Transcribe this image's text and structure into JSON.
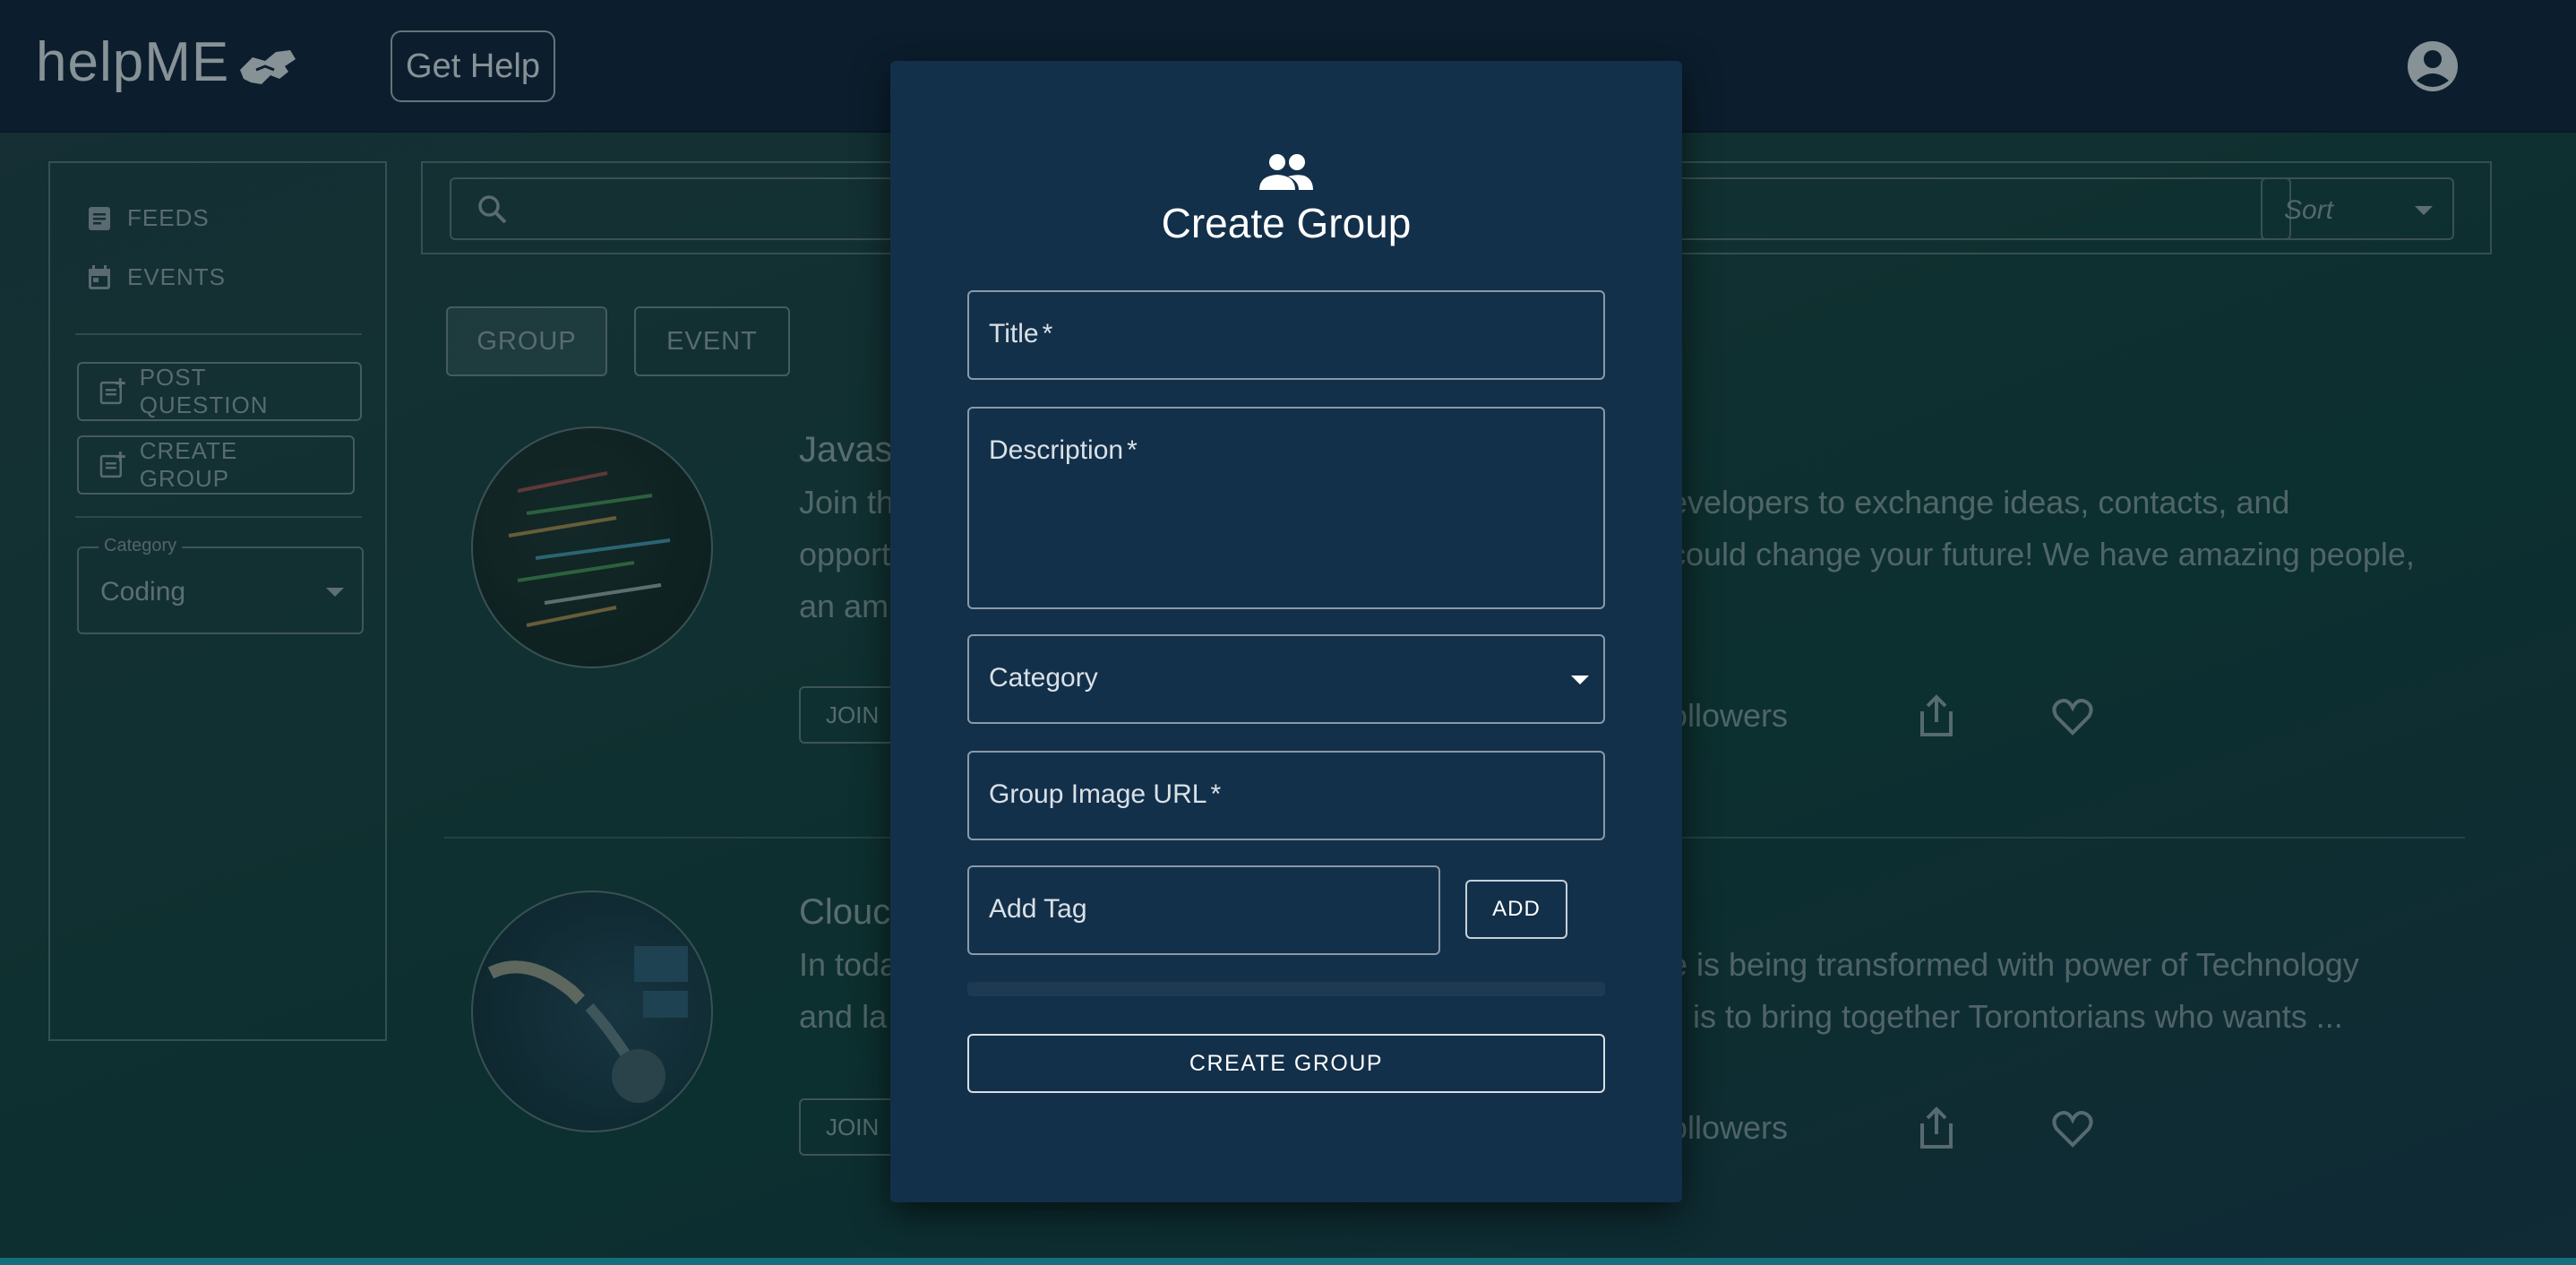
{
  "header": {
    "logo_text": "helpME",
    "get_help_label": "Get Help"
  },
  "sidebar": {
    "links": [
      {
        "label": "FEEDS",
        "icon": "article-icon"
      },
      {
        "label": "EVENTS",
        "icon": "calendar-icon"
      }
    ],
    "buttons": [
      {
        "label": "POST QUESTION",
        "icon": "post-add-icon"
      },
      {
        "label": "CREATE GROUP",
        "icon": "post-add-icon"
      }
    ],
    "category": {
      "legend": "Category",
      "value": "Coding"
    }
  },
  "toolbar": {
    "search_placeholder": "",
    "sort_label": "Sort"
  },
  "tabs": [
    {
      "label": "GROUP",
      "active": true
    },
    {
      "label": "EVENT",
      "active": false
    }
  ],
  "cards": [
    {
      "title_visible": "Javas",
      "desc_lines": [
        {
          "left": "Join th",
          "right": "evelopers to exchange ideas, contacts, and"
        },
        {
          "left": "opport",
          "right": "could change your future! We have amazing people,"
        },
        {
          "left": "an am",
          "right": ""
        }
      ],
      "join_label": "JOIN",
      "followers_label": "ollowers"
    },
    {
      "title_visible": "Clouc",
      "desc_lines": [
        {
          "left": "In toda",
          "right": "e is being transformed with power of Technology"
        },
        {
          "left": "and la",
          "right": "is to bring together Torontorians who wants ..."
        }
      ],
      "join_label": "JOIN",
      "followers_label": "ollowers"
    }
  ],
  "modal": {
    "icon": "group-icon",
    "title": "Create Group",
    "fields": {
      "title_label": "Title",
      "description_label": "Description",
      "category_label": "Category",
      "image_url_label": "Group Image URL",
      "tag_label": "Add Tag",
      "required_marker": "*"
    },
    "add_button": "ADD",
    "submit_button": "CREATE GROUP"
  },
  "colors": {
    "header_bg": "#0e2234",
    "modal_bg": "#13304a",
    "page_bg": "#163b3a"
  }
}
